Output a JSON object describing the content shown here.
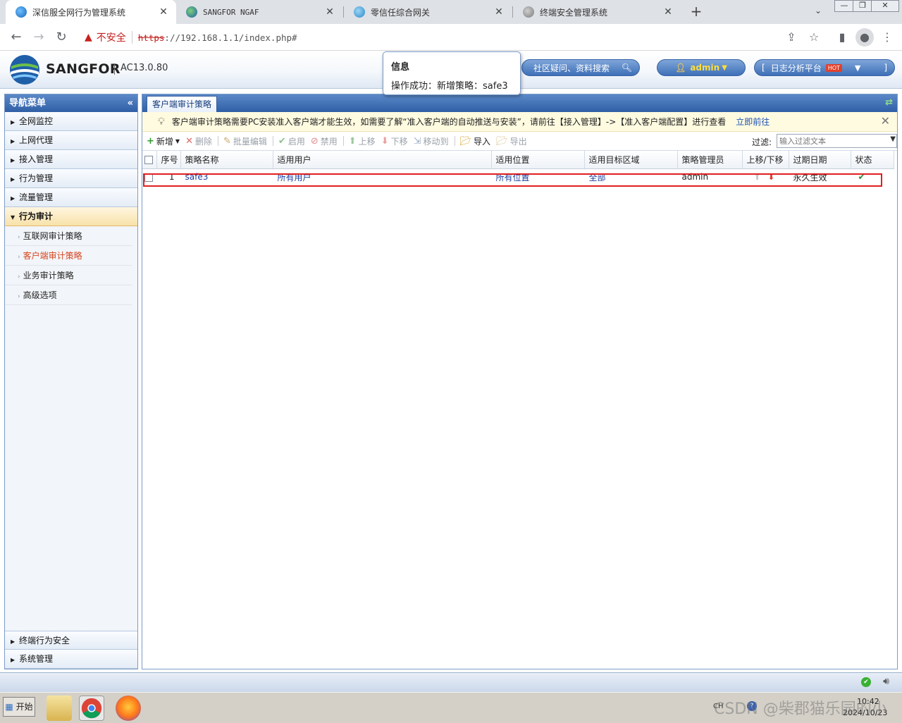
{
  "browser": {
    "tabs": [
      {
        "title": "深信服全网行为管理系统",
        "active": true
      },
      {
        "title": "SANGFOR NGAF",
        "active": false
      },
      {
        "title": "零信任综合网关",
        "active": false
      },
      {
        "title": "终端安全管理系统",
        "active": false
      }
    ],
    "new_tab_glyph": "+",
    "tab_list_glyph": "⌄",
    "security_label": "不安全",
    "url_scheme": "https",
    "url_rest": "://192.168.1.1/index.php#"
  },
  "header": {
    "brand": "SANGFOR",
    "version": "AC13.0.80",
    "search_label": "社区疑问、资料搜索",
    "user": "admin",
    "log_platform": "日志分析平台",
    "hot_badge": "HOT"
  },
  "popup": {
    "title": "信息",
    "body": "操作成功：新增策略：safe3"
  },
  "sidebar": {
    "title": "导航菜单",
    "items": [
      {
        "label": "全网监控",
        "open": false
      },
      {
        "label": "上网代理",
        "open": false
      },
      {
        "label": "接入管理",
        "open": false
      },
      {
        "label": "行为管理",
        "open": false
      },
      {
        "label": "流量管理",
        "open": false
      },
      {
        "label": "行为审计",
        "open": true
      }
    ],
    "subitems": [
      {
        "label": "互联网审计策略",
        "active": false
      },
      {
        "label": "客户端审计策略",
        "active": true
      },
      {
        "label": "业务审计策略",
        "active": false
      },
      {
        "label": "高级选项",
        "active": false
      }
    ],
    "bottom_items": [
      {
        "label": "终端行为安全"
      },
      {
        "label": "系统管理"
      }
    ]
  },
  "main": {
    "tab_label": "客户端审计策略",
    "notice": "客户端审计策略需要PC安装准入客户端才能生效，如需要了解“准入客户端的自动推送与安装”，请前往【接入管理】->【准入客户端配置】进行查看",
    "notice_link": "立即前往",
    "toolbar": {
      "add": "新增",
      "delete": "删除",
      "batch_edit": "批量编辑",
      "enable": "启用",
      "disable": "禁用",
      "move_up": "上移",
      "move_down": "下移",
      "move_to": "移动到",
      "import": "导入",
      "export": "导出",
      "filter_label": "过滤:",
      "filter_placeholder": "输入过滤文本"
    },
    "table": {
      "columns": [
        "序号",
        "策略名称",
        "适用用户",
        "适用位置",
        "适用目标区域",
        "策略管理员",
        "上移/下移",
        "过期日期",
        "状态"
      ],
      "rows": [
        {
          "index": "1",
          "name": "safe3",
          "users": "所有用户",
          "location": "所有位置",
          "zone": "全部",
          "admin": "admin",
          "expiry": "永久生效",
          "status": "enabled"
        }
      ]
    }
  },
  "taskbar": {
    "start": "开始",
    "ime": "CH",
    "time": "10:42",
    "date": "2024/10/23"
  },
  "watermark": "CSDN @柴郡猫乐园的小",
  "colors": {
    "accent": "#2f5fa6",
    "link": "#1a3c9e",
    "active_menu": "#d6451f",
    "highlight_border": "#e02020"
  }
}
